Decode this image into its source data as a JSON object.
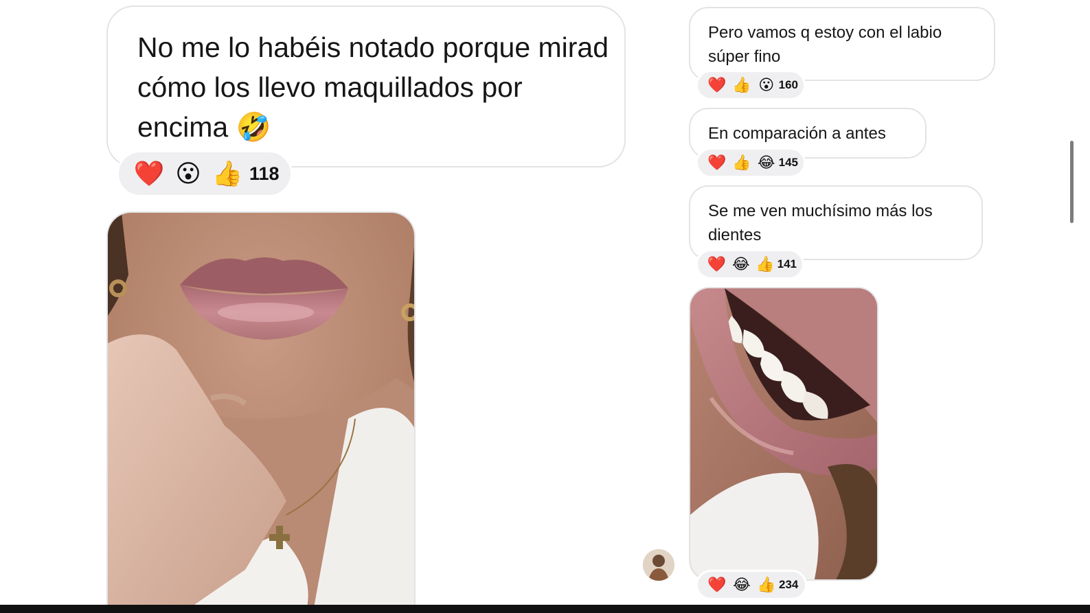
{
  "messages_left": {
    "big_bubble": {
      "text": "No me lo habéis notado porque mirad cómo los llevo maquillados por encima 🤣",
      "reactions": [
        "❤️",
        "😮",
        "👍"
      ],
      "count": "118"
    }
  },
  "messages_right": [
    {
      "text": "Pero vamos q estoy con el labio súper fino",
      "reactions": [
        "❤️",
        "👍",
        "😮"
      ],
      "count": "160"
    },
    {
      "text": "En comparación a antes",
      "reactions": [
        "❤️",
        "👍",
        "😂"
      ],
      "count": "145"
    },
    {
      "text": "Se me ven muchísimo más los dientes",
      "reactions": [
        "❤️",
        "😂",
        "👍"
      ],
      "count": "141"
    }
  ],
  "photo_right": {
    "reactions": [
      "❤️",
      "😂",
      "👍"
    ],
    "count": "234"
  },
  "colors": {
    "bubble_border": "#e3e3e6",
    "reaction_bg": "#efeff1",
    "text": "#161616"
  }
}
